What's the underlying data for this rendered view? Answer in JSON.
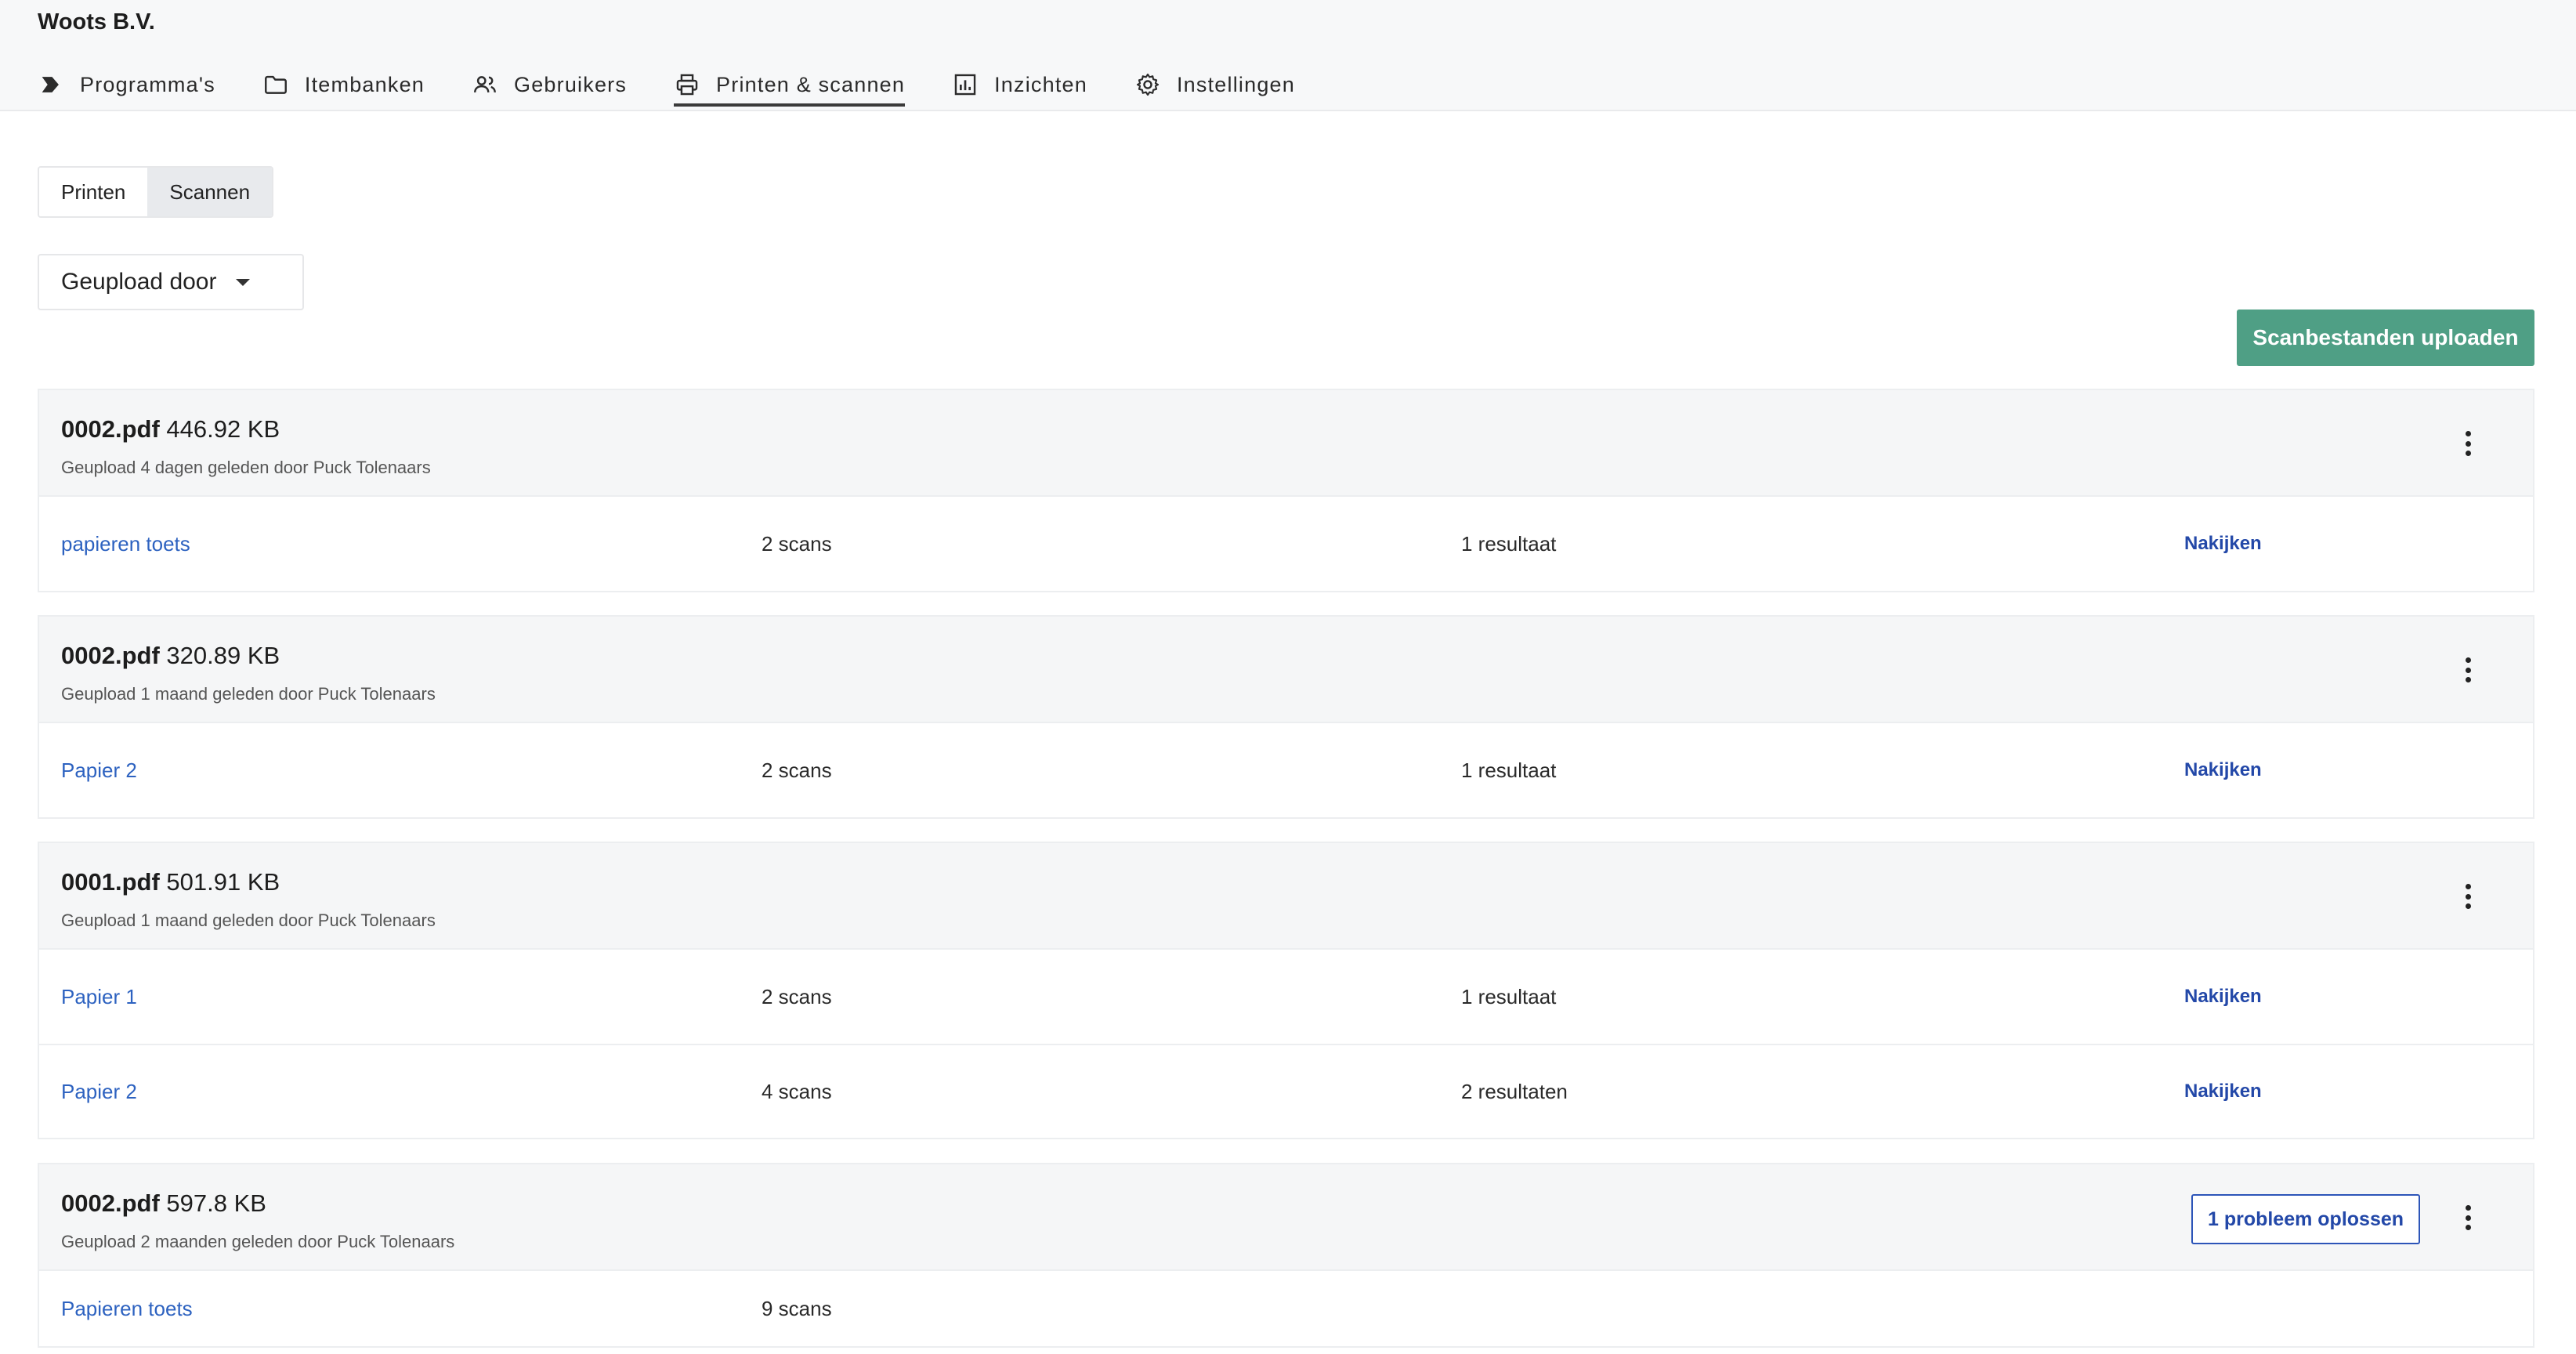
{
  "org": {
    "name": "Woots B.V."
  },
  "nav": [
    {
      "label": "Programma's",
      "icon": "chevron-tag-icon",
      "active": false
    },
    {
      "label": "Itembanken",
      "icon": "folder-icon",
      "active": false
    },
    {
      "label": "Gebruikers",
      "icon": "users-icon",
      "active": false
    },
    {
      "label": "Printen & scannen",
      "icon": "printer-icon",
      "active": true
    },
    {
      "label": "Inzichten",
      "icon": "bar-chart-icon",
      "active": false
    },
    {
      "label": "Instellingen",
      "icon": "gear-icon",
      "active": false
    }
  ],
  "tabs": {
    "print": "Printen",
    "scan": "Scannen",
    "selected": "Scannen"
  },
  "filter": {
    "label": "Geupload door"
  },
  "upload_button": "Scanbestanden uploaden",
  "groups": [
    {
      "file": "0002.pdf",
      "size": "446.92 KB",
      "meta": "Geupload 4 dagen geleden door Puck Tolenaars",
      "rows": [
        {
          "name": "papieren toets",
          "scans": "2 scans",
          "results": "1 resultaat",
          "action": "Nakijken"
        }
      ]
    },
    {
      "file": "0002.pdf",
      "size": "320.89 KB",
      "meta": "Geupload 1 maand geleden door Puck Tolenaars",
      "rows": [
        {
          "name": "Papier 2",
          "scans": "2 scans",
          "results": "1 resultaat",
          "action": "Nakijken"
        }
      ]
    },
    {
      "file": "0001.pdf",
      "size": "501.91 KB",
      "meta": "Geupload 1 maand geleden door Puck Tolenaars",
      "rows": [
        {
          "name": "Papier 1",
          "scans": "2 scans",
          "results": "1 resultaat",
          "action": "Nakijken"
        },
        {
          "name": "Papier 2",
          "scans": "4 scans",
          "results": "2 resultaten",
          "action": "Nakijken"
        }
      ]
    },
    {
      "file": "0002.pdf",
      "size": "597.8 KB",
      "meta": "Geupload 2 maanden geleden door Puck Tolenaars",
      "problem_button": "1 probleem oplossen",
      "rows": [
        {
          "name": "Papieren toets",
          "scans": "9 scans",
          "results": "",
          "action": ""
        }
      ]
    }
  ]
}
